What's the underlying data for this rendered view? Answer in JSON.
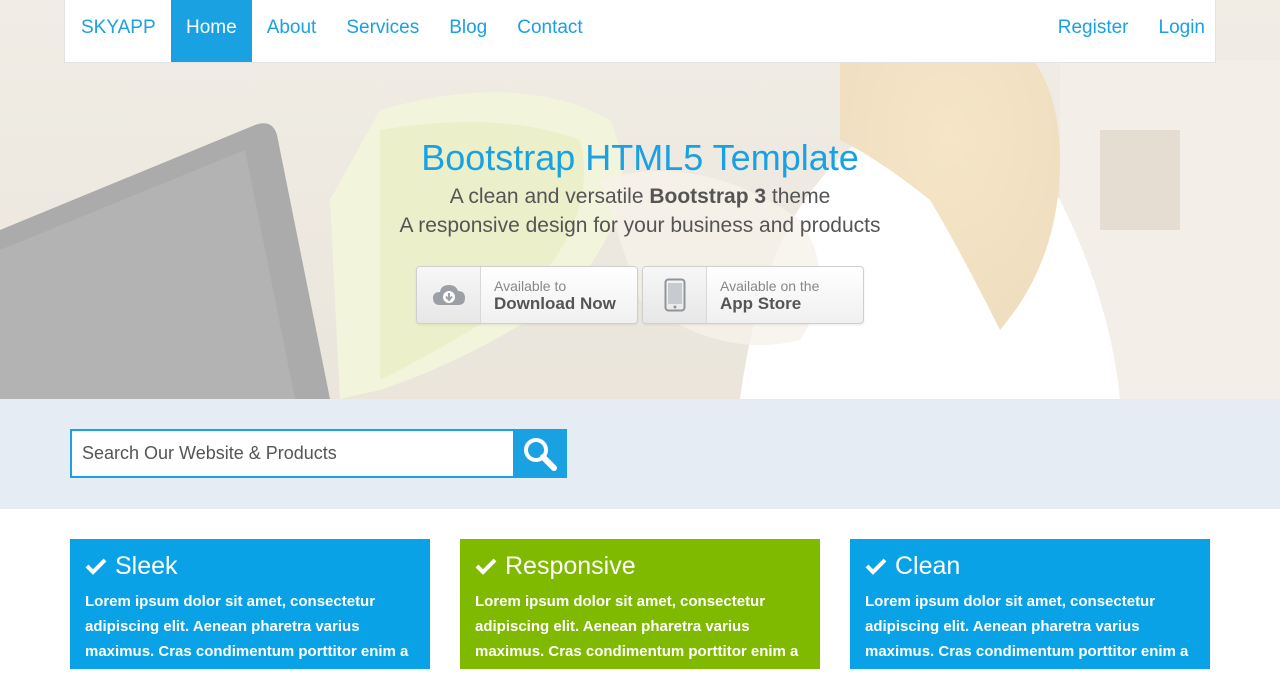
{
  "nav": {
    "brand": "SKYAPP",
    "links": [
      "Home",
      "About",
      "Services",
      "Blog",
      "Contact"
    ],
    "active": "Home",
    "register": "Register",
    "login": "Login"
  },
  "hero": {
    "title": "Bootstrap HTML5 Template",
    "line1_prefix": "A clean and versatile",
    "line1_bold": "Bootstrap 3",
    "line1_suffix": "theme",
    "line2": "A responsive design for your business and products",
    "download": {
      "small": "Available to",
      "big": "Download Now",
      "icon": "cloud-download-icon"
    },
    "appstore": {
      "small": "Available on the",
      "big": "App Store",
      "icon": "mobile-phone-icon"
    }
  },
  "search": {
    "placeholder": "Search Our Website & Products",
    "icon": "search-icon"
  },
  "features": [
    {
      "title": "Sleek",
      "color": "#0aa2e6",
      "icon": "check-icon",
      "text": "Lorem ipsum dolor sit amet, consectetur adipiscing elit. Aenean pharetra varius maximus. Cras condimentum porttitor enim a egestas."
    },
    {
      "title": "Responsive",
      "color": "#7fba00",
      "icon": "check-icon",
      "text": "Lorem ipsum dolor sit amet, consectetur adipiscing elit. Aenean pharetra varius maximus. Cras condimentum porttitor enim a egestas."
    },
    {
      "title": "Clean",
      "color": "#0aa2e6",
      "icon": "check-icon",
      "text": "Lorem ipsum dolor sit amet, consectetur adipiscing elit. Aenean pharetra varius maximus. Cras condimentum porttitor enim a egestas."
    }
  ],
  "colors": {
    "accent": "#1aa1e1",
    "green": "#7fba00",
    "search_strip": "#e6ecf3"
  }
}
